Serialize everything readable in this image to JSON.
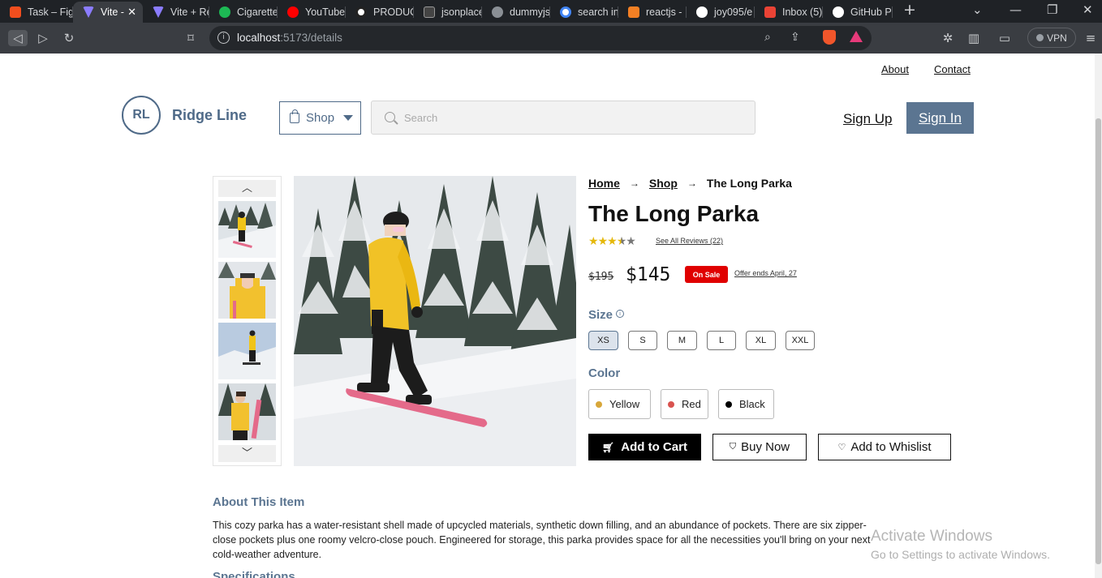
{
  "browser": {
    "tabs": [
      {
        "label": "Task – Fig",
        "icon": "figma-icon",
        "color": "#f24e1e"
      },
      {
        "label": "Vite -",
        "icon": "vite-icon",
        "color": "#8b7cff",
        "active": true
      },
      {
        "label": "Vite + Re",
        "icon": "vite-icon",
        "color": "#8b7cff"
      },
      {
        "label": "Cigarette",
        "icon": "spotify-icon",
        "color": "#1db954"
      },
      {
        "label": "YouTube",
        "icon": "youtube-icon",
        "color": "#ff0000"
      },
      {
        "label": "PRODUC",
        "icon": "product-icon",
        "color": "#ffffff"
      },
      {
        "label": "jsonplace",
        "icon": "jsonplaceholder-icon",
        "color": "#444444"
      },
      {
        "label": "dummyjs",
        "icon": "globe-icon",
        "color": "#8a8f95"
      },
      {
        "label": "search in",
        "icon": "google-icon",
        "color": "#4285f4"
      },
      {
        "label": "reactjs -",
        "icon": "stackoverflow-icon",
        "color": "#f48024"
      },
      {
        "label": "joy095/e",
        "icon": "github-icon",
        "color": "#ffffff"
      },
      {
        "label": "Inbox (5)",
        "icon": "gmail-icon",
        "color": "#ea4335"
      },
      {
        "label": "GitHub P",
        "icon": "github-icon",
        "color": "#ffffff"
      }
    ],
    "close_glyph": "✕",
    "new_tab_glyph": "+",
    "url_host": "localhost",
    "url_path": ":5173/details",
    "vpn_label": "VPN"
  },
  "header": {
    "top_links": {
      "about": "About",
      "contact": "Contact"
    },
    "logo_initials": "RL",
    "logo_name": "Ridge Line",
    "shop_label": "Shop",
    "search_placeholder": "Search",
    "sign_up": "Sign Up",
    "sign_in": "Sign In"
  },
  "product": {
    "breadcrumbs": {
      "home": "Home",
      "shop": "Shop",
      "current": "The Long Parka",
      "arrow": "→"
    },
    "title": "The Long Parka",
    "rating": 3.5,
    "rating_max": 5,
    "reviews_link": "See All Reviews (22)",
    "old_price": "$195",
    "price": "$145",
    "sale_badge": "On Sale",
    "offer_text": "Offer ends April, 27",
    "size_label": "Size",
    "sizes": [
      "XS",
      "S",
      "M",
      "L",
      "XL",
      "XXL"
    ],
    "selected_size": "XS",
    "color_label": "Color",
    "colors": [
      {
        "name": "Yellow",
        "hex": "#d8a73a"
      },
      {
        "name": "Red",
        "hex": "#d9534f"
      },
      {
        "name": "Black",
        "hex": "#000000"
      }
    ],
    "add_to_cart": "Add to Cart",
    "buy_now": "Buy Now",
    "wishlist": "Add to Whislist",
    "thumb_up": "︿",
    "thumb_down": "﹀"
  },
  "about": {
    "heading": "About This Item",
    "body": "This cozy parka has a water-resistant shell made of upcycled materials, synthetic down filling, and an abundance of pockets. There are six zipper-close pockets plus one roomy velcro-close pouch. Engineered for storage, this parka provides space for all the necessities you'll bring on your next cold-weather adventure.",
    "specs_heading": "Specifications"
  },
  "watermark": {
    "line1": "Activate Windows",
    "line2": "Go to Settings to activate Windows."
  },
  "colors": {
    "brand": "#4f6a88",
    "button_blue": "#5b7591",
    "sale_red": "#e00000",
    "star": "#e5b80b"
  }
}
